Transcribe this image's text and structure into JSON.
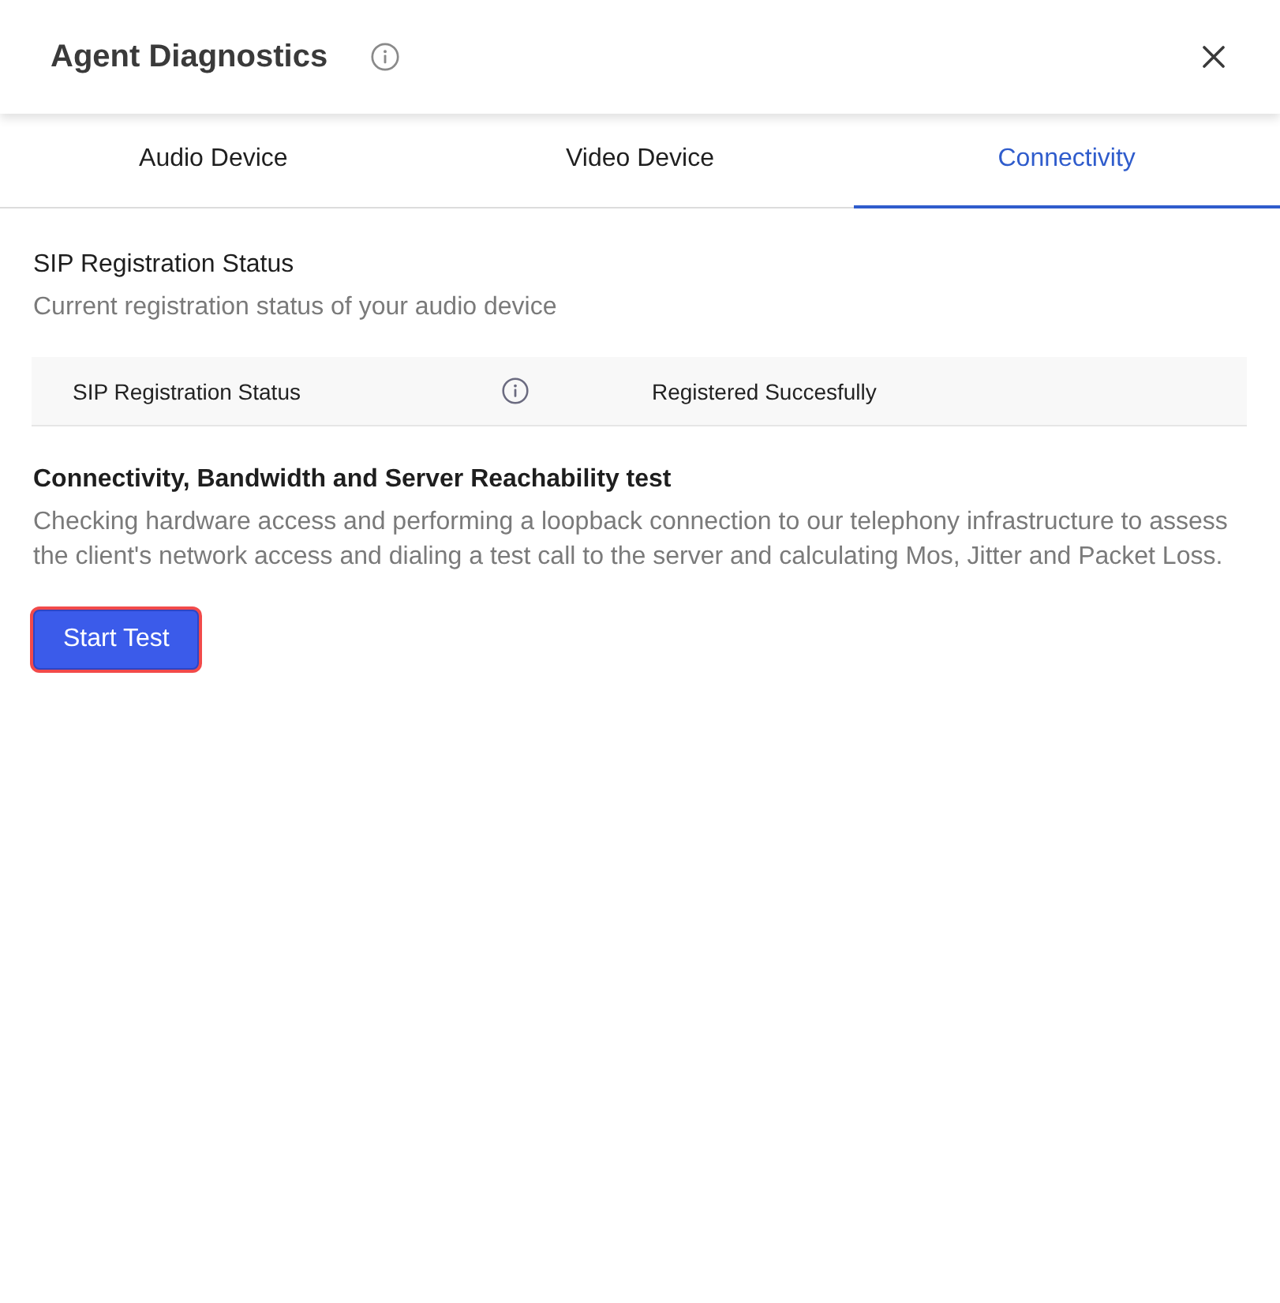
{
  "dialog": {
    "title": "Agent Diagnostics"
  },
  "tabs": [
    {
      "label": "Audio Device",
      "selected": false
    },
    {
      "label": "Video Device",
      "selected": false
    },
    {
      "label": "Connectivity",
      "selected": true
    }
  ],
  "sections": [
    {
      "kind": "status",
      "title": "SIP Registration Status",
      "description": "Current registration status of your audio device",
      "rows": [
        {
          "label": "SIP Registration Status",
          "value": "Registered Succesfully"
        }
      ]
    },
    {
      "kind": "test",
      "title": "Connectivity, Bandwidth and Server Reachability test",
      "description": "Checking hardware access and performing a loopback connection to our telephony infrastructure to assess the client's network access and dialing a test call to the server and calculating Mos, Jitter and Packet Loss.",
      "button": {
        "label": "Start Test",
        "focused": true
      }
    }
  ]
}
